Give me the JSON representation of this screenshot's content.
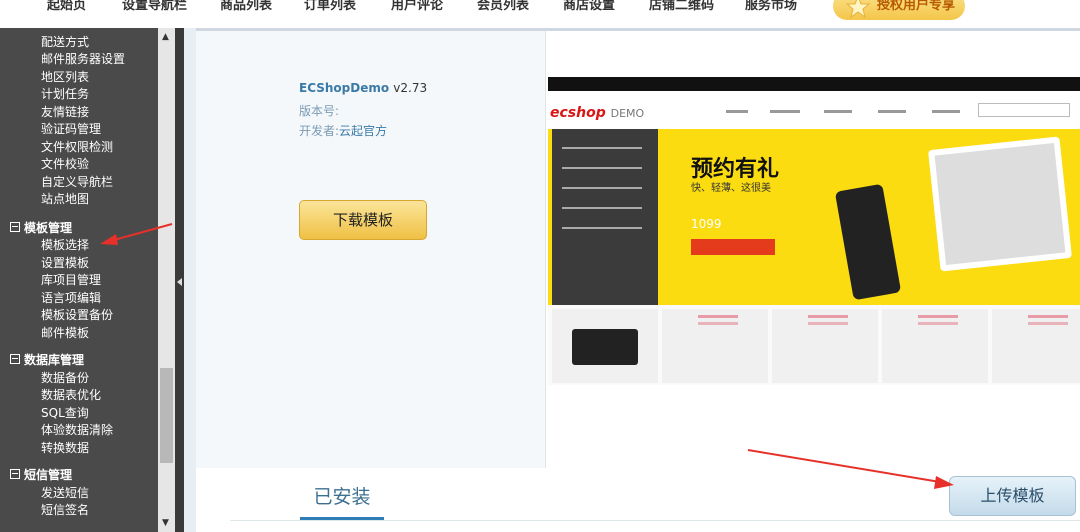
{
  "topnav": {
    "items": [
      "起始页",
      "设置导航栏",
      "商品列表",
      "订单列表",
      "用户评论",
      "会员列表",
      "商店设置",
      "店铺二维码",
      "服务市场"
    ],
    "vip_label": "授权用户专享"
  },
  "sidebar": {
    "system_items": [
      "配送方式",
      "邮件服务器设置",
      "地区列表",
      "计划任务",
      "友情链接",
      "验证码管理",
      "文件权限检测",
      "文件校验",
      "自定义导航栏",
      "站点地图"
    ],
    "groups": [
      {
        "title": "模板管理",
        "items": [
          "模板选择",
          "设置模板",
          "库项目管理",
          "语言项编辑",
          "模板设置备份",
          "邮件模板"
        ]
      },
      {
        "title": "数据库管理",
        "items": [
          "数据备份",
          "数据表优化",
          "SQL查询",
          "体验数据清除",
          "转换数据"
        ]
      },
      {
        "title": "短信管理",
        "items": [
          "发送短信",
          "短信签名"
        ]
      }
    ]
  },
  "theme": {
    "name": "ECShopDemo",
    "version": "v2.73",
    "version_label": "版本号:",
    "developer_label": "开发者:",
    "developer": "云起官方",
    "download_label": "下载模板"
  },
  "preview": {
    "logo": "ecshop",
    "logo_suffix": "DEMO",
    "hero_title": "预约有礼",
    "hero_sub": "快、轻薄、这很美",
    "price": "1099"
  },
  "tabs": {
    "installed_label": "已安装"
  },
  "upload_label": "上传模板",
  "colors": {
    "sidebar_bg": "#4a4a4a",
    "accent_blue": "#2e7db4",
    "annotation_red": "#e8302a",
    "hero_yellow": "#fbdc11"
  }
}
